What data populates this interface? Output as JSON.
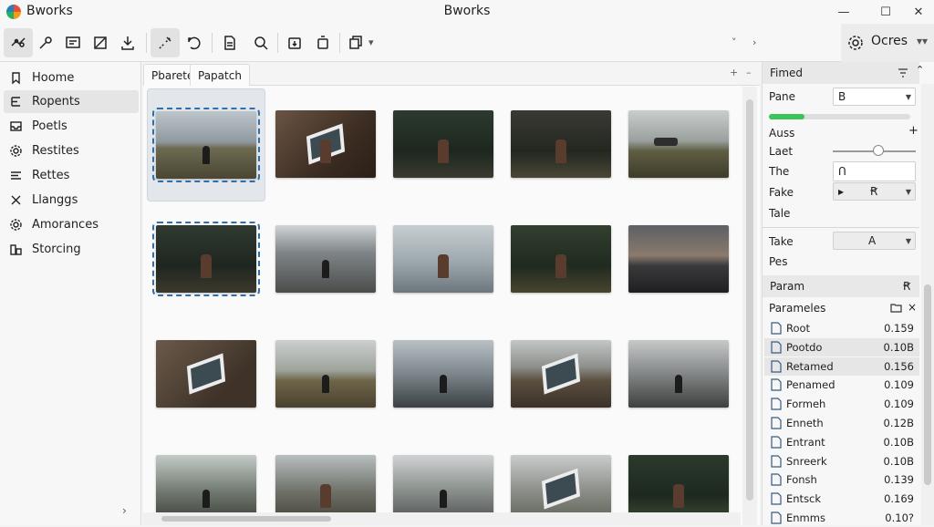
{
  "app": {
    "name": "Bworks",
    "window_title": "Bworks"
  },
  "window_controls": {
    "minimize": "—",
    "maximize": "☐",
    "close": "✕"
  },
  "toolbar": {
    "left_dropdown": "▾",
    "nav_prev": "˅",
    "nav_next": "›",
    "right_button_label": "Ocres",
    "right_more": "▾▾"
  },
  "sidebar": {
    "items": [
      {
        "label": "Hoome",
        "icon": "bookmark-icon"
      },
      {
        "label": "Ropents",
        "icon": "branch-icon"
      },
      {
        "label": "Poetls",
        "icon": "tray-icon"
      },
      {
        "label": "Restites",
        "icon": "gear-icon"
      },
      {
        "label": "Rettes",
        "icon": "list-icon"
      },
      {
        "label": "Llanggs",
        "icon": "tools-icon"
      },
      {
        "label": "Amorances",
        "icon": "gear-icon"
      },
      {
        "label": "Storcing",
        "icon": "storage-icon"
      }
    ],
    "collapse_chevron": "›"
  },
  "tabs": {
    "items": [
      "Pbarete",
      "Papatch"
    ],
    "ctl_plus": "+",
    "ctl_minus": "–"
  },
  "thumbnails": [
    {
      "scene": "man standing in field",
      "bg": "linear-gradient(#bcc5c9 0%,#8f9aa0 45%,#6d6a52 55%,#4a4632 100%)"
    },
    {
      "scene": "woman holding picture frame on wood",
      "bg": "linear-gradient(135deg,#6a5444,#3c2d22 60%,#2a1f17)"
    },
    {
      "scene": "woman in dark forest",
      "bg": "linear-gradient(#2d3a2e,#1d271f 60%,#3a3a30)"
    },
    {
      "scene": "woman sitting in forest",
      "bg": "linear-gradient(#3a3a34,#222820 60%,#4a4536)"
    },
    {
      "scene": "car on grassy hill",
      "bg": "linear-gradient(#c9cdcc 0%,#9aa19d 45%,#5f5e44 60%,#3e3b28 100%)"
    },
    {
      "scene": "woman crouching in forest",
      "bg": "linear-gradient(#2f3a30,#1f2620 60%,#3c392c)"
    },
    {
      "scene": "figure in canyon",
      "bg": "linear-gradient(#d0d4d6 0%,#7f8588 40%,#4b4d4b 100%)"
    },
    {
      "scene": "woman with long hair by water",
      "bg": "linear-gradient(#c7cdd0,#9ca8ad 55%,#6b777c)"
    },
    {
      "scene": "woman sitting in forest",
      "bg": "linear-gradient(#33402f,#202a20 60%,#48452f)"
    },
    {
      "scene": "pier at sunset",
      "bg": "linear-gradient(#5c6066 0%,#8a7a6c 45%,#3a3a3c 60%,#1f1f22 100%)"
    },
    {
      "scene": "picture frame on wooden floor",
      "bg": "linear-gradient(135deg,#6b5a4a,#3f3329 70%)"
    },
    {
      "scene": "man in open field",
      "bg": "linear-gradient(#cbd0cf 0%,#9ea39b 45%,#6e6549 60%,#4a4230 100%)"
    },
    {
      "scene": "couple by river",
      "bg": "linear-gradient(#b9c1c5,#7c868b 50%,#3b4044)"
    },
    {
      "scene": "picture frame on deck",
      "bg": "linear-gradient(#c2c6c6 0%,#8c8f8b 40%,#5b4f40 60%,#3b3128 100%)"
    },
    {
      "scene": "person walking on wet shore",
      "bg": "linear-gradient(#c7c9c9 0%,#8a8d8d 45%,#3e3f3f 100%)"
    },
    {
      "scene": "person on road near cliffs",
      "bg": "linear-gradient(#c4cbc8,#6f786f 55%,#3d3f39)"
    },
    {
      "scene": "woman sitting by rocks",
      "bg": "linear-gradient(#b7bfbf,#6e7068 55%,#454238)"
    },
    {
      "scene": "person on road in valley",
      "bg": "linear-gradient(#d0d3d4,#8d9490 50%,#4f5050)"
    },
    {
      "scene": "frame on grassy ground",
      "bg": "linear-gradient(#c9cccc,#8f928d 50%,#5e6154)"
    },
    {
      "scene": "woman in green forest",
      "bg": "linear-gradient(#2c3a2c,#1d291f 60%,#3e4a35)"
    }
  ],
  "panel": {
    "header_filter": "Fimed",
    "fields": {
      "pane_label": "Pane",
      "pane_value": "B",
      "progress_fraction": 0.25,
      "auss_label": "Auss",
      "auss_add": "+",
      "last_label": "Laet",
      "last_slider_fraction": 0.55,
      "the_label": "The",
      "the_value": "Ո",
      "fake_label": "Fake",
      "fake_value": "Ꞧ",
      "tale_label": "Tale",
      "take_label": "Take",
      "take_value": "A",
      "pes_label": "Pes"
    },
    "param_header": "Param",
    "param_header_icon": "Ꞧ",
    "params_label": "Parameles",
    "params_close": "×",
    "rows": [
      {
        "name": "Root",
        "value": "0.159"
      },
      {
        "name": "Pootdo",
        "value": "0.10B"
      },
      {
        "name": "Retamed",
        "value": "0.156"
      },
      {
        "name": "Penamed",
        "value": "0.109"
      },
      {
        "name": "Formeh",
        "value": "0.109"
      },
      {
        "name": "Enneth",
        "value": "0.12B"
      },
      {
        "name": "Entrant",
        "value": "0.10B"
      },
      {
        "name": "Snreerk",
        "value": "0.10B"
      },
      {
        "name": "Fonsh",
        "value": "0.139"
      },
      {
        "name": "Entsck",
        "value": "0.169"
      },
      {
        "name": "Enmms",
        "value": "0.10?"
      }
    ]
  },
  "colors": {
    "accent": "#2e6fb0",
    "progress": "#3cc45a"
  }
}
